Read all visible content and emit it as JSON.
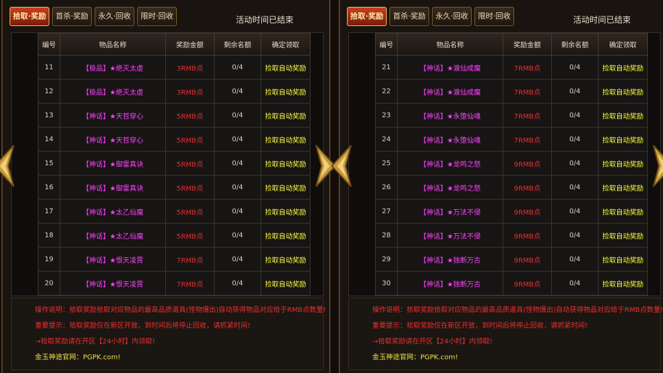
{
  "tabs": [
    "拾取·奖励",
    "首杀·奖励",
    "永久·回收",
    "限时·回收"
  ],
  "status": "活动时间已结束",
  "headers": [
    "编号",
    "物品名称",
    "奖励金额",
    "剩余名额",
    "确定领取"
  ],
  "panels": [
    {
      "rows": [
        {
          "id": "11",
          "name": "【极品】★绝灭太虚",
          "amount": "3RMB点",
          "remain": "0/4",
          "action": "捡取自动奖励"
        },
        {
          "id": "12",
          "name": "【极品】★绝灭太虚",
          "amount": "3RMB点",
          "remain": "0/4",
          "action": "捡取自动奖励"
        },
        {
          "id": "13",
          "name": "【神话】★天哲穿心",
          "amount": "5RMB点",
          "remain": "0/4",
          "action": "捡取自动奖励"
        },
        {
          "id": "14",
          "name": "【神话】★天哲穿心",
          "amount": "5RMB点",
          "remain": "0/4",
          "action": "捡取自动奖励"
        },
        {
          "id": "15",
          "name": "【神话】★御雷真诀",
          "amount": "5RMB点",
          "remain": "0/4",
          "action": "捡取自动奖励"
        },
        {
          "id": "16",
          "name": "【神话】★御雷真诀",
          "amount": "5RMB点",
          "remain": "0/4",
          "action": "捡取自动奖励"
        },
        {
          "id": "17",
          "name": "【神话】★太乙仙魔",
          "amount": "5RMB点",
          "remain": "0/4",
          "action": "捡取自动奖励"
        },
        {
          "id": "18",
          "name": "【神话】★太乙仙魔",
          "amount": "5RMB点",
          "remain": "0/4",
          "action": "捡取自动奖励"
        },
        {
          "id": "19",
          "name": "【神话】★恨天凌霄",
          "amount": "7RMB点",
          "remain": "0/4",
          "action": "捡取自动奖励"
        },
        {
          "id": "20",
          "name": "【神话】★恨天凌霄",
          "amount": "7RMB点",
          "remain": "0/4",
          "action": "捡取自动奖励"
        }
      ]
    },
    {
      "rows": [
        {
          "id": "21",
          "name": "【神话】★渡仙成魔",
          "amount": "7RMB点",
          "remain": "0/4",
          "action": "捡取自动奖励"
        },
        {
          "id": "22",
          "name": "【神话】★渡仙成魔",
          "amount": "7RMB点",
          "remain": "0/4",
          "action": "捡取自动奖励"
        },
        {
          "id": "23",
          "name": "【神话】★永堕仙魂",
          "amount": "7RMB点",
          "remain": "0/4",
          "action": "捡取自动奖励"
        },
        {
          "id": "24",
          "name": "【神话】★永堕仙魂",
          "amount": "7RMB点",
          "remain": "0/4",
          "action": "捡取自动奖励"
        },
        {
          "id": "25",
          "name": "【神话】★龙鸣之怒",
          "amount": "9RMB点",
          "remain": "0/4",
          "action": "捡取自动奖励"
        },
        {
          "id": "26",
          "name": "【神话】★龙鸣之怒",
          "amount": "9RMB点",
          "remain": "0/4",
          "action": "捡取自动奖励"
        },
        {
          "id": "27",
          "name": "【神话】★万法不侵",
          "amount": "9RMB点",
          "remain": "0/4",
          "action": "捡取自动奖励"
        },
        {
          "id": "28",
          "name": "【神话】★万法不侵",
          "amount": "9RMB点",
          "remain": "0/4",
          "action": "捡取自动奖励"
        },
        {
          "id": "29",
          "name": "【神话】★独断万古",
          "amount": "9RMB点",
          "remain": "0/4",
          "action": "捡取自动奖励"
        },
        {
          "id": "30",
          "name": "【神话】★独断万古",
          "amount": "9RMB点",
          "remain": "0/4",
          "action": "捡取自动奖励"
        }
      ]
    }
  ],
  "info": {
    "line1": "操作说明：拾取奖励拾取对应物品的最高品质道具(怪物爆出)自动获得物品对应给于RMB点数量!",
    "line2": "重要提示：拾取奖励仅在新区开放，到时间后将停止回收，请抓紧时间!",
    "line3": "→拾取奖励请在开区【24小时】内领取!",
    "line4": "金玉神途官网：PGPK.com!"
  },
  "colors": {
    "name": "#ff40ff",
    "amount": "#e03030",
    "action": "#ffff40",
    "tab_active": "#c8401a"
  },
  "icons": [
    "arrow-left-icon",
    "arrow-right-icon"
  ]
}
